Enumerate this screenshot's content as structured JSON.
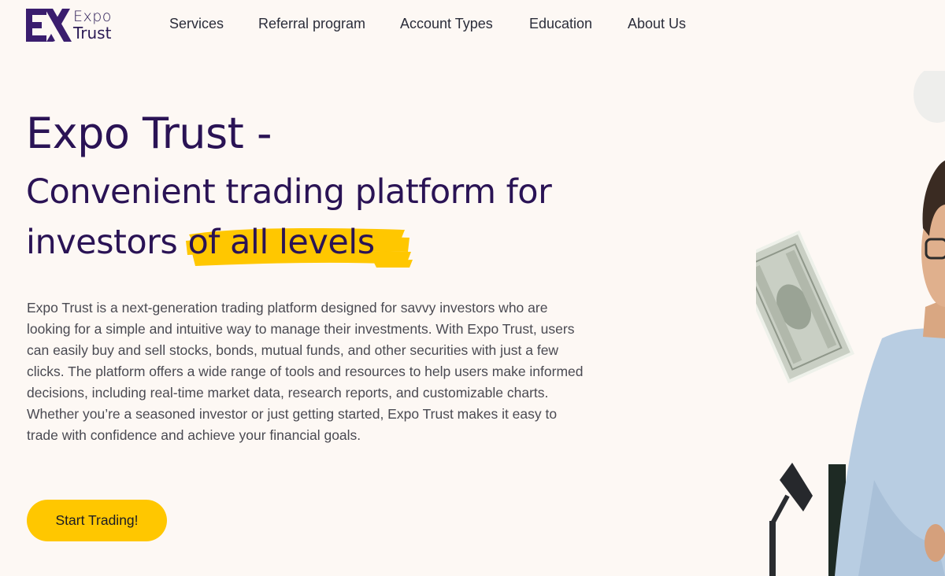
{
  "brand": {
    "line1": "Expo",
    "line2": "Trust",
    "mark_color": "#3a1d6e"
  },
  "nav": {
    "items": [
      {
        "label": "Services"
      },
      {
        "label": "Referral program"
      },
      {
        "label": "Account Types"
      },
      {
        "label": "Education"
      },
      {
        "label": "About Us"
      }
    ]
  },
  "hero": {
    "title": "Expo Trust -",
    "subtitle_start": "Convenient trading platform for investors ",
    "subtitle_highlight": "of all levels",
    "description": "Expo Trust is a next-generation trading platform designed for savvy investors who are looking for a simple and intuitive way to manage their investments. With Expo Trust, users can easily buy and sell stocks, bonds, mutual funds, and other securities with just a few clicks. The platform offers a wide range of tools and resources to help users make informed decisions, including real-time market data, research reports, and customizable charts. Whether you’re a seasoned investor or just getting started, Expo Trust makes it easy to trade with confidence and achieve your financial goals.",
    "cta_label": "Start Trading!"
  },
  "colors": {
    "background": "#fdf8f4",
    "heading": "#2a1355",
    "accent_yellow": "#ffc700",
    "body_text": "#4a4a52"
  },
  "icons": {
    "logo": "expo-trust-logo-icon",
    "brush": "yellow-brush-highlight",
    "art": "man-with-banknote-and-desk-lamp"
  }
}
